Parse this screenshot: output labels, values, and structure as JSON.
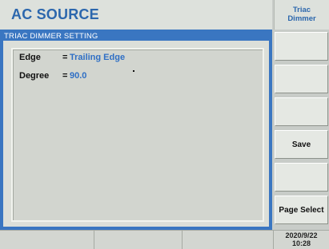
{
  "header": {
    "title": "AC SOURCE",
    "mode_line1": "Triac",
    "mode_line2": "Dimmer"
  },
  "panel": {
    "title": "TRIAC DIMMER SETTING",
    "rows": [
      {
        "label": "Edge",
        "eq": "=",
        "value": "Trailing Edge"
      },
      {
        "label": "Degree",
        "eq": "=",
        "value": "90.0"
      }
    ]
  },
  "softkeys": [
    "",
    "",
    "",
    "Save",
    "",
    "Page Select"
  ],
  "status": {
    "cells": [
      "",
      "",
      ""
    ],
    "date": "2020/9/22",
    "time": "10:28"
  },
  "colors": {
    "accent": "#2c67ad",
    "panel_blue": "#3a76c1",
    "value_blue": "#2f6fc5"
  }
}
